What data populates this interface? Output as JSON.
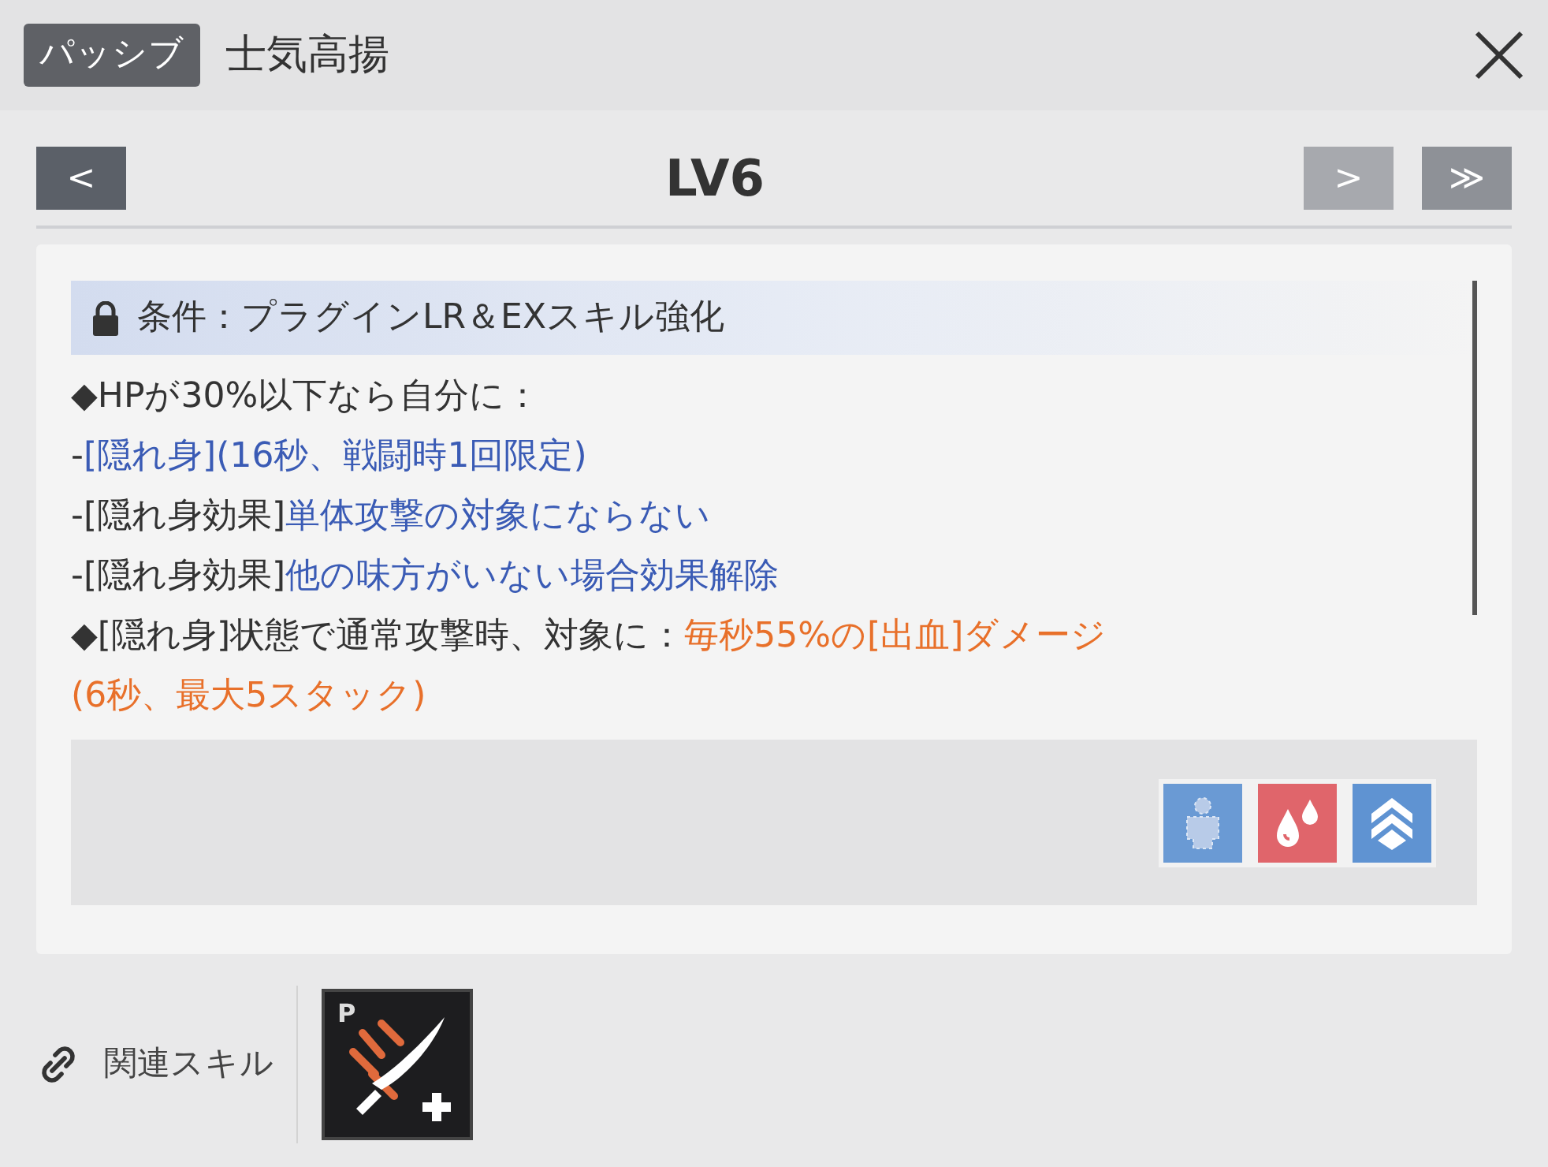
{
  "header": {
    "badge": "パッシブ",
    "title": "士気高揚"
  },
  "nav": {
    "prev": "<",
    "level": "LV6",
    "next": ">",
    "last": "≫"
  },
  "condition": "条件：プラグインLR＆EXスキル強化",
  "lines": [
    [
      {
        "kind": "plain",
        "text": "◆HPが30%以下なら自分に："
      }
    ],
    [
      {
        "kind": "plain",
        "text": "-"
      },
      {
        "kind": "status",
        "text": "[隠れ身](16秒、戦闘時1回限定)"
      }
    ],
    [
      {
        "kind": "plain",
        "text": "-[隠れ身効果]"
      },
      {
        "kind": "status",
        "text": "単体攻撃の対象にならない"
      }
    ],
    [
      {
        "kind": "plain",
        "text": "-[隠れ身効果]"
      },
      {
        "kind": "status",
        "text": "他の味方がいない場合効果解除"
      }
    ],
    [
      {
        "kind": "plain",
        "text": "◆[隠れ身]状態で通常攻撃時、対象に："
      },
      {
        "kind": "damage",
        "text": "毎秒55%の[出血]ダメージ"
      }
    ],
    [
      {
        "kind": "damage",
        "text": "(6秒、最大5スタック)"
      }
    ]
  ],
  "effect_icons": [
    {
      "kind": "stealth",
      "color": "#6a9ad4"
    },
    {
      "kind": "bleed",
      "color": "#e0656b"
    },
    {
      "kind": "buff",
      "color": "#5f93d2"
    }
  ],
  "related": {
    "label": "関連スキル",
    "skills": [
      {
        "tag": "P"
      }
    ]
  }
}
